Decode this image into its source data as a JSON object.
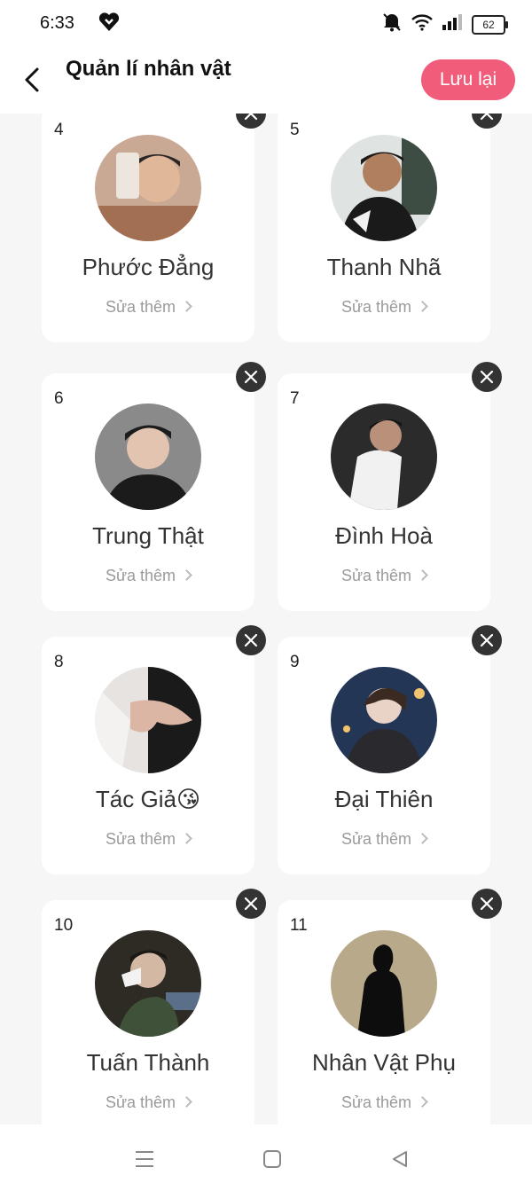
{
  "status": {
    "time": "6:33",
    "battery": "62"
  },
  "header": {
    "title": "Quản lí nhân vật",
    "save_label": "Lưu lại"
  },
  "edit_more_label": "Sửa thêm",
  "cards": [
    {
      "num": "4",
      "name": "Phước Đẳng",
      "avatar_color": "#b9876a"
    },
    {
      "num": "5",
      "name": "Thanh Nhã",
      "avatar_color": "#3b3b3b"
    },
    {
      "num": "6",
      "name": "Trung Thật",
      "avatar_color": "#7a7a7a"
    },
    {
      "num": "7",
      "name": "Đình Hoà",
      "avatar_color": "#2d2d2d"
    },
    {
      "num": "8",
      "name": "Tác Giả😘",
      "avatar_color": "#d9cfcb"
    },
    {
      "num": "9",
      "name": "Đại Thiên",
      "avatar_color": "#1e2a44"
    },
    {
      "num": "10",
      "name": "Tuấn Thành",
      "avatar_color": "#3a3226"
    },
    {
      "num": "11",
      "name": "Nhân Vật Phụ",
      "avatar_color": "#b8a98a"
    }
  ]
}
